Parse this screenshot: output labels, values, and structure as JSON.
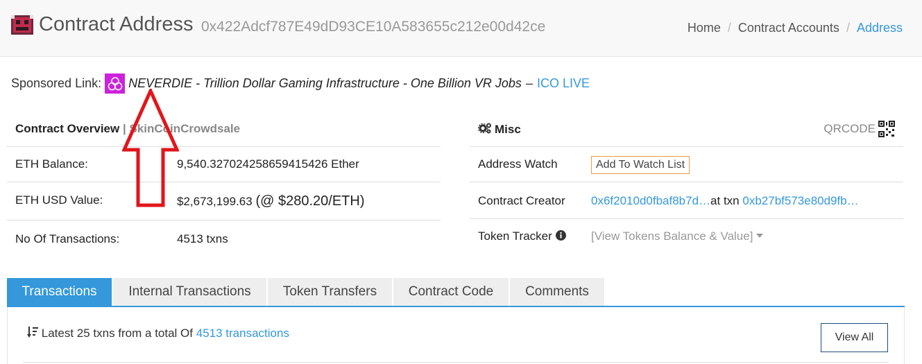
{
  "header": {
    "title": "Contract Address",
    "address": "0x422Adcf787E49dD93CE10A583655c212e00d42ce",
    "breadcrumb": {
      "home": "Home",
      "contracts": "Contract Accounts",
      "current": "Address"
    }
  },
  "sponsored": {
    "label": "Sponsored Link:",
    "text": "NEVERDIE - Trillion Dollar Gaming Infrastructure - One Billion VR Jobs",
    "dash": "–",
    "cta": "ICO LIVE"
  },
  "overview": {
    "title": "Contract Overview",
    "subtitle": "| SkinCoinCrowdsale",
    "rows": [
      {
        "label": "ETH Balance:",
        "value": "9,540.327024258659415426 Ether"
      },
      {
        "label": "ETH USD Value:",
        "value": "$2,673,199.63",
        "extra": "(@ $280.20/ETH)"
      },
      {
        "label": "No Of Transactions:",
        "value": "4513 txns"
      }
    ]
  },
  "misc": {
    "title": "Misc",
    "qrcode": "QRCODE",
    "address_watch": {
      "label": "Address Watch",
      "button": "Add To Watch List"
    },
    "creator": {
      "label": "Contract Creator",
      "address": "0x6f2010d0fbaf8b7d…",
      "at_txn": "at txn",
      "txn": "0xb27bf573e80d9fb…"
    },
    "token_tracker": {
      "label": "Token Tracker",
      "value": "[View Tokens Balance & Value]"
    }
  },
  "tabs": [
    "Transactions",
    "Internal Transactions",
    "Token Transfers",
    "Contract Code",
    "Comments"
  ],
  "transactions": {
    "prefix": "Latest 25 txns from a total Of",
    "count_link": "4513 transactions",
    "view_all": "View All"
  },
  "colors": {
    "accent": "#3498db",
    "annotation_arrow": "#e0161b",
    "watch_border": "#e39e48",
    "sponsor_icon": "#cc22dd"
  }
}
